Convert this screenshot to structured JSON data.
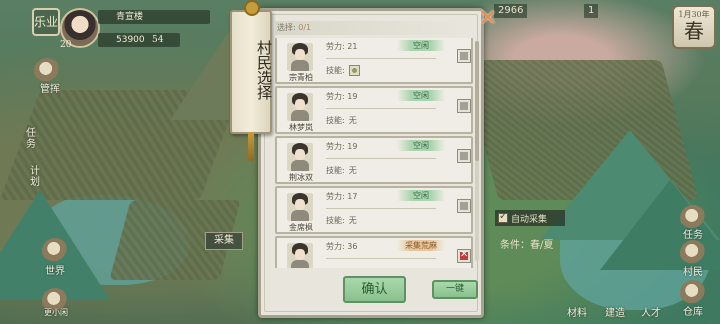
{
  "hud": {
    "left_badge": "乐业",
    "player_name": "青宣楼",
    "level": "20",
    "money": "53900",
    "dots_count": "54",
    "top_counter": "2966",
    "top_counter2": "1",
    "season_year": "1月30年",
    "season": "春"
  },
  "left_menu": [
    {
      "label": "管挥",
      "icon": "manage-icon"
    },
    {
      "label": "任务",
      "icon": "task-icon"
    },
    {
      "label": "计划",
      "icon": "plan-icon"
    },
    {
      "label": "世界",
      "icon": "world-icon"
    },
    {
      "label": "更小闲",
      "icon": "leisure-icon"
    }
  ],
  "right_menu": [
    {
      "label": "任务",
      "icon": "task-right-icon"
    },
    {
      "label": "村民",
      "icon": "villager-icon"
    },
    {
      "label": "仓库",
      "icon": "warehouse-icon"
    }
  ],
  "bottom_menu": [
    {
      "label": "建造"
    },
    {
      "label": "材料"
    },
    {
      "label": "人才"
    }
  ],
  "field_tag": "采集",
  "auto_collect": {
    "label": "自动采集",
    "checked": true
  },
  "condition_text": "条件：春/夏",
  "dialog": {
    "banner_title": "村民选择",
    "selection_label": "选择:",
    "selection_count": "0/1",
    "villagers": [
      {
        "name": "宗青柏",
        "labor": "劳力: 21",
        "status": "空闲",
        "status_type": "idle",
        "skill_label": "技能:",
        "skill": "",
        "skill_has_icon": true,
        "selected": false
      },
      {
        "name": "林梦岚",
        "labor": "劳力: 19",
        "status": "空闲",
        "status_type": "idle",
        "skill_label": "技能:",
        "skill": "无",
        "skill_has_icon": false,
        "selected": false
      },
      {
        "name": "荆冰双",
        "labor": "劳力: 19",
        "status": "空闲",
        "status_type": "idle",
        "skill_label": "技能:",
        "skill": "无",
        "skill_has_icon": false,
        "selected": false
      },
      {
        "name": "金席枫",
        "labor": "劳力: 17",
        "status": "空闲",
        "status_type": "idle",
        "skill_label": "技能:",
        "skill": "无",
        "skill_has_icon": false,
        "selected": false
      },
      {
        "name": "",
        "labor": "劳力: 36",
        "status": "采集荒麻",
        "status_type": "busy",
        "skill_label": "",
        "skill": "",
        "skill_has_icon": false,
        "selected": true
      }
    ],
    "confirm_label": "确认",
    "onekey_label": "一键"
  }
}
